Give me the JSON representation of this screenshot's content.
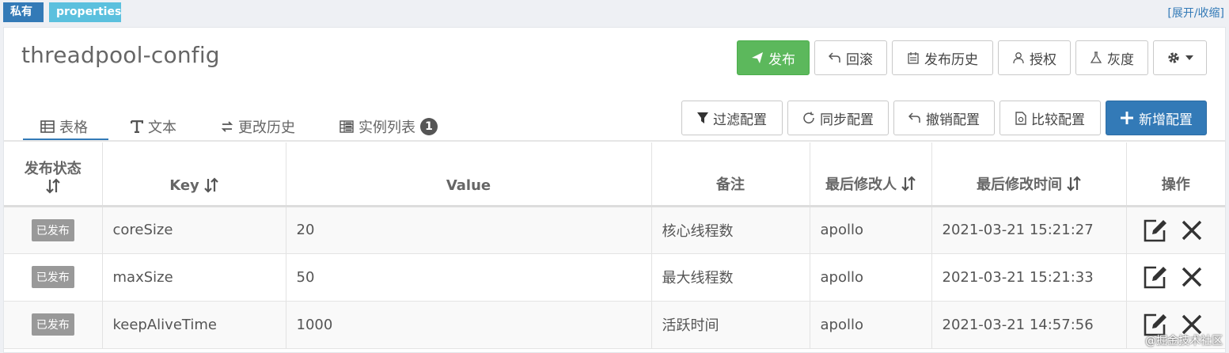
{
  "tags": {
    "private": "私有",
    "format": "properties"
  },
  "toggle_link": "[展开/收缩]",
  "namespace": {
    "title": "threadpool-config"
  },
  "toolbar": {
    "publish": "发布",
    "rollback": "回滚",
    "history": "发布历史",
    "authorize": "授权",
    "gray": "灰度"
  },
  "tabs": [
    {
      "label": "表格",
      "icon": "table-icon"
    },
    {
      "label": "文本",
      "icon": "text-icon"
    },
    {
      "label": "更改历史",
      "icon": "exchange-icon"
    },
    {
      "label": "实例列表",
      "icon": "server-list-icon",
      "badge": "1"
    }
  ],
  "actions": {
    "filter": "过滤配置",
    "sync": "同步配置",
    "revoke": "撤销配置",
    "compare": "比较配置",
    "add": "新增配置"
  },
  "table": {
    "headers": {
      "status": "发布状态",
      "key": "Key",
      "value": "Value",
      "comment": "备注",
      "modifier": "最后修改人",
      "modified_time": "最后修改时间",
      "ops": "操作"
    },
    "rows": [
      {
        "status": "已发布",
        "key": "coreSize",
        "value": "20",
        "comment": "核心线程数",
        "modifier": "apollo",
        "time": "2021-03-21 15:21:27"
      },
      {
        "status": "已发布",
        "key": "maxSize",
        "value": "50",
        "comment": "最大线程数",
        "modifier": "apollo",
        "time": "2021-03-21 15:21:33"
      },
      {
        "status": "已发布",
        "key": "keepAliveTime",
        "value": "1000",
        "comment": "活跃时间",
        "modifier": "apollo",
        "time": "2021-03-21 14:57:56"
      }
    ]
  },
  "watermark": "@掘金技术社区",
  "colors": {
    "primary": "#337ab7",
    "success": "#5cb85c",
    "info": "#5bc0de",
    "muted": "#999999"
  }
}
